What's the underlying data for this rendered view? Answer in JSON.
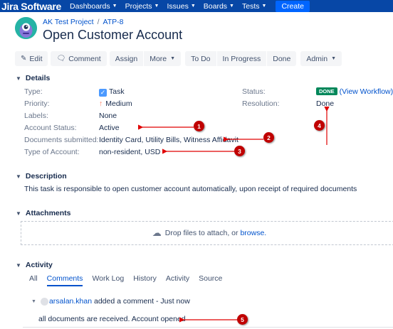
{
  "nav": {
    "brand": "Jira Software",
    "items": [
      "Dashboards",
      "Projects",
      "Issues",
      "Boards",
      "Tests"
    ],
    "create": "Create"
  },
  "issue": {
    "project": "AK Test Project",
    "key": "ATP-8",
    "title": "Open Customer Account"
  },
  "toolbar": {
    "edit": "Edit",
    "comment": "Comment",
    "assign": "Assign",
    "more": "More",
    "todo": "To Do",
    "inprogress": "In Progress",
    "done": "Done",
    "admin": "Admin"
  },
  "details": {
    "heading": "Details",
    "type_label": "Type:",
    "type_value": "Task",
    "priority_label": "Priority:",
    "priority_value": "Medium",
    "labels_label": "Labels:",
    "labels_value": "None",
    "account_status_label": "Account Status:",
    "account_status_value": "Active",
    "documents_label": "Documents submitted:",
    "documents_value": "Identity Card, Utility Bills, Witness Affidavit",
    "account_type_label": "Type of Account:",
    "account_type_value": "non-resident, USD",
    "status_label": "Status:",
    "status_value": "DONE",
    "view_workflow": "(View Workflow)",
    "resolution_label": "Resolution:",
    "resolution_value": "Done"
  },
  "description": {
    "heading": "Description",
    "text": "This task is responsible to open customer account automatically, upon receipt of required documents"
  },
  "attachments": {
    "heading": "Attachments",
    "drop_text": "Drop files to attach, or",
    "browse": "browse."
  },
  "activity": {
    "heading": "Activity",
    "tabs": [
      "All",
      "Comments",
      "Work Log",
      "History",
      "Activity",
      "Source"
    ],
    "comment_user": "arsalan.khan",
    "comment_meta": "added a comment - Just now",
    "comment_text": "all documents are received. Account opened"
  },
  "annotations": [
    "1",
    "2",
    "3",
    "4",
    "5"
  ],
  "colors": {
    "nav_bg": "#0747a6",
    "create_bg": "#0065ff",
    "link": "#0052cc",
    "done_lozenge": "#00875a",
    "annotation": "#c00000"
  }
}
